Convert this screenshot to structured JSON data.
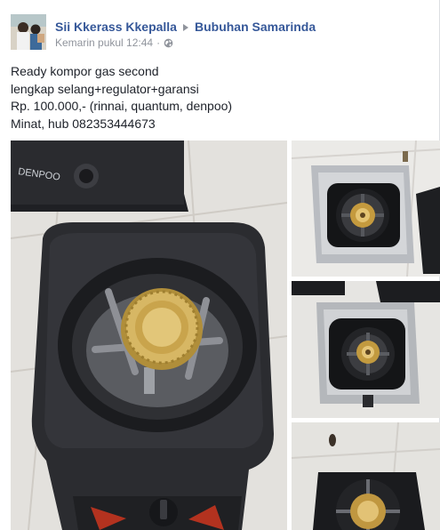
{
  "post": {
    "author": "Sii Kkerass Kkepalla",
    "group": "Bubuhan Samarinda",
    "timestamp": "Kemarin pukul 12:44",
    "separator": "·",
    "lines": [
      "Ready kompor gas second",
      "lengkap selang+regulator+garansi",
      "Rp. 100.000,- (rinnai, quantum, denpoo)",
      "Minat, hub 082353444673"
    ]
  },
  "photo_labels": {
    "main_stove_brand": "DENPOO"
  },
  "icons": {
    "share_arrow": "triangle-right-icon",
    "privacy": "globe-icon"
  },
  "colors": {
    "link": "#365899",
    "meta": "#90949c",
    "text": "#1d2129"
  }
}
